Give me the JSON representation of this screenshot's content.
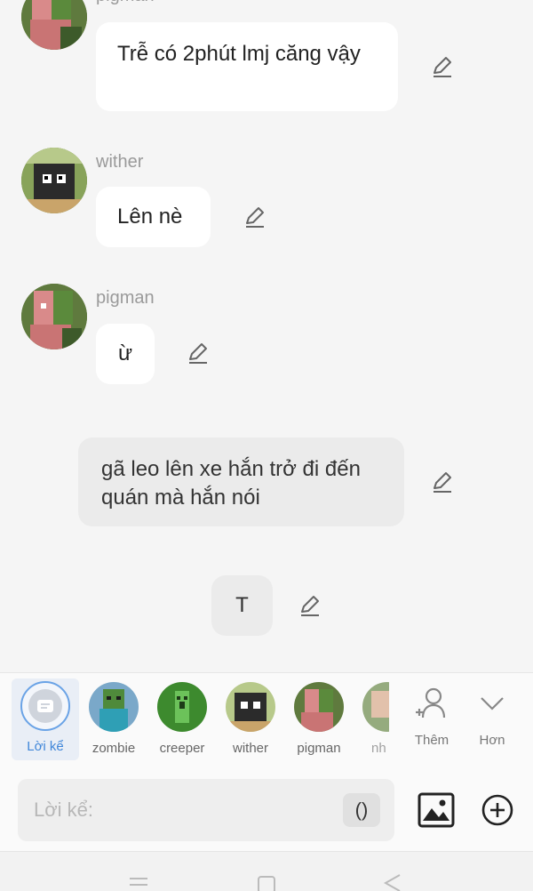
{
  "messages": [
    {
      "sender": "pigman",
      "text": "Trễ có 2phút lmj căng vậy"
    },
    {
      "sender": "wither",
      "text": "Lên nè"
    },
    {
      "sender": "pigman",
      "text": "ừ"
    }
  ],
  "narration": [
    {
      "text": "gã leo lên xe hắn trở đi đến quán mà hắn nói"
    },
    {
      "text": "T"
    }
  ],
  "cast": {
    "items": [
      {
        "label": "Lời kể"
      },
      {
        "label": "zombie"
      },
      {
        "label": "creeper"
      },
      {
        "label": "wither"
      },
      {
        "label": "pigman"
      },
      {
        "label": "nh"
      }
    ],
    "add_label": "Thêm",
    "more_label": "Hơn"
  },
  "composer": {
    "placeholder": "Lời kể:",
    "paren_label": "()"
  },
  "colors": {
    "accent": "#3f86d9",
    "bubble": "#ffffff",
    "narration_bubble": "#ebebeb"
  }
}
